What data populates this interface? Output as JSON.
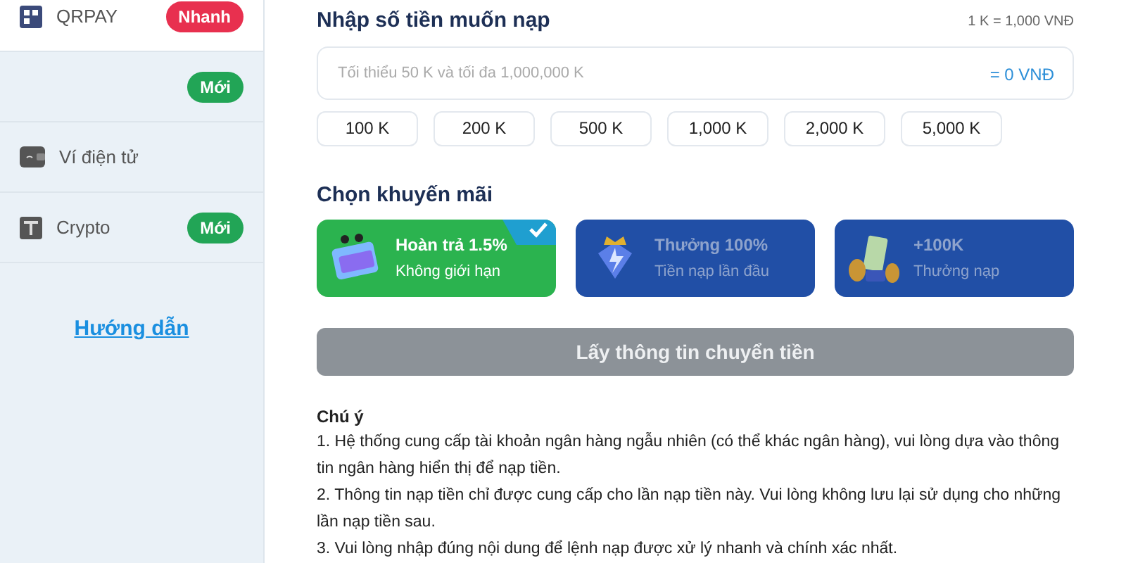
{
  "sidebar": {
    "items": [
      {
        "kind": "qr",
        "label": "QRPAY",
        "badge": "Nhanh",
        "color": "#e8304f",
        "selected": true
      },
      {
        "kind": "plain",
        "badge": "Mới",
        "color": "#22a556",
        "selected": false
      },
      {
        "kind": "wallet",
        "label": "Ví điện tử",
        "selected": false
      },
      {
        "kind": "crypto",
        "label": "Crypto",
        "badge": "Mới",
        "color": "#22a556",
        "selected": false
      }
    ],
    "guide_link": "Hướng dẫn"
  },
  "amount": {
    "title": "Nhập số tiền muốn nạp",
    "rate": "1 K = 1,000 VNĐ",
    "placeholder": "Tối thiểu 50 K và tối đa 1,000,000 K",
    "converted": "= 0 VNĐ",
    "presets": [
      "100 K",
      "200 K",
      "500 K",
      "1,000 K",
      "2,000 K",
      "5,000 K"
    ]
  },
  "promotions": {
    "title": "Chọn khuyến mãi",
    "items": [
      {
        "title": "Hoàn trả 1.5%",
        "subtitle": "Không giới hạn",
        "selected": true
      },
      {
        "title": "Thưởng 100%",
        "subtitle": "Tiền nạp lần đầu",
        "selected": false
      },
      {
        "title": "+100K",
        "subtitle": "Thưởng nạp",
        "selected": false
      }
    ]
  },
  "submit": {
    "label": "Lấy thông tin chuyển tiền",
    "disabled": true
  },
  "notes": {
    "title": "Chú ý",
    "lines": [
      "1. Hệ thống cung cấp tài khoản ngân hàng ngẫu nhiên (có thể khác ngân hàng), vui lòng dựa vào thông tin ngân hàng hiển thị để nạp tiền.",
      "2. Thông tin nạp tiền chỉ được cung cấp cho lần nạp tiền này. Vui lòng không lưu lại sử dụng cho những lần nạp tiền sau.",
      "3. Vui lòng nhập đúng nội dung để lệnh nạp được xử lý nhanh và chính xác nhất."
    ]
  }
}
